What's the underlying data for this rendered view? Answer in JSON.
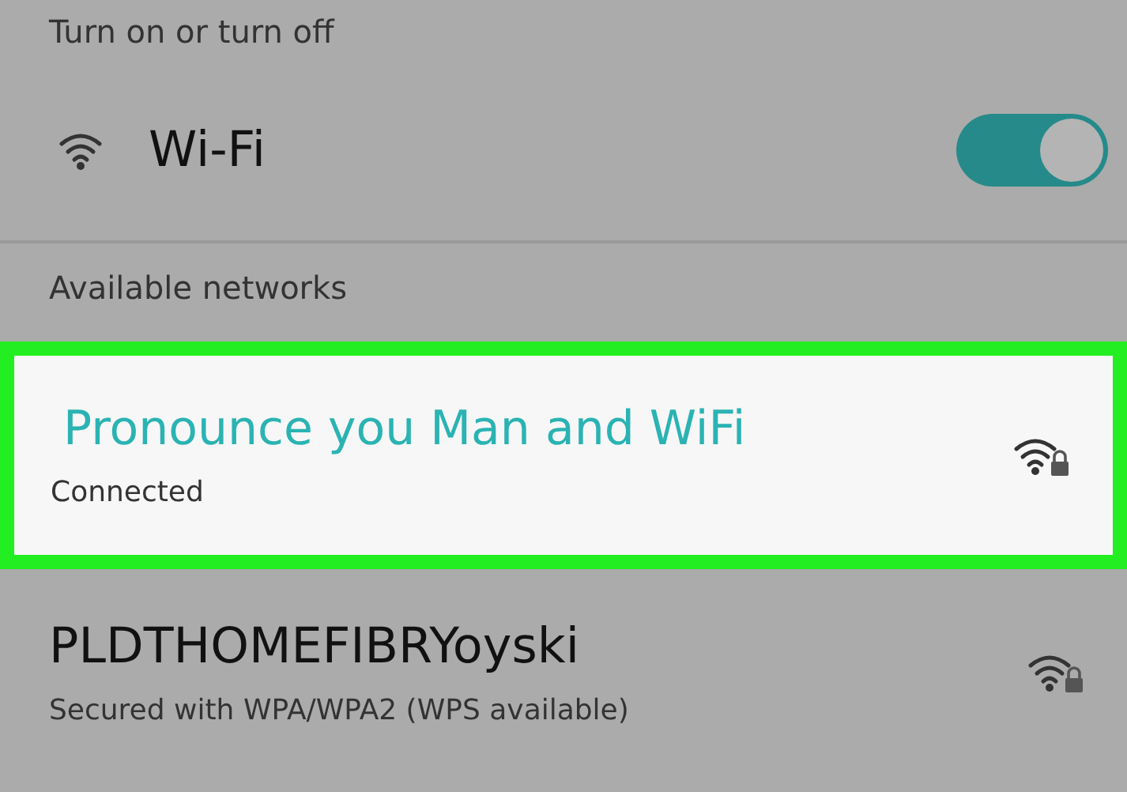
{
  "header": "Turn on or turn off",
  "wifi": {
    "label": "Wi-Fi",
    "on": true
  },
  "section": "Available networks",
  "networks": [
    {
      "name": "Pronounce you Man and WiFi",
      "status": "Connected",
      "highlighted": true,
      "connected": true
    },
    {
      "name": "PLDTHOMEFIBRYoyski",
      "status": "Secured with WPA/WPA2 (WPS available)",
      "highlighted": false,
      "connected": false
    }
  ]
}
